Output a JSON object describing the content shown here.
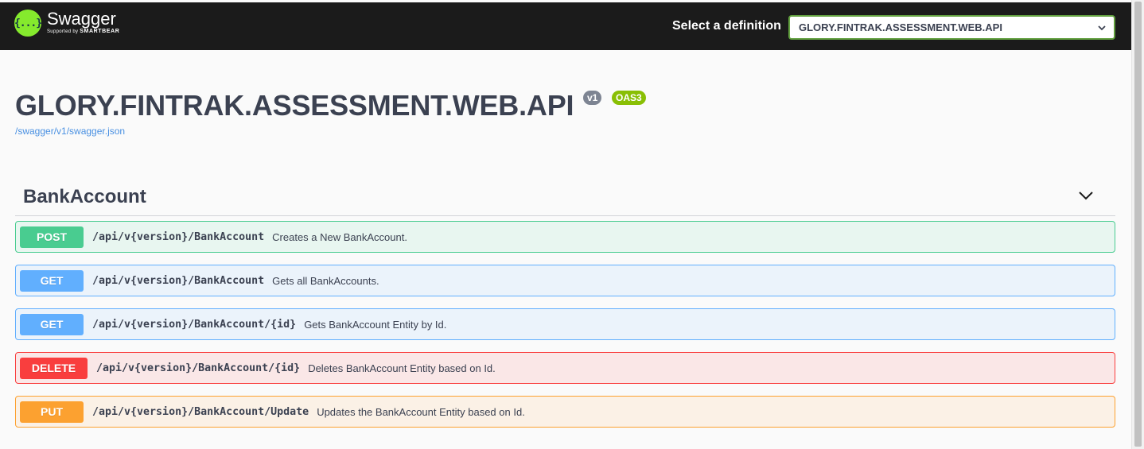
{
  "header": {
    "logo": {
      "glyph": "{...}",
      "name": "Swagger",
      "sub_prefix": "Supported by",
      "sub_brand": "SMARTBEAR"
    },
    "definition_label": "Select a definition",
    "definition_selected": "GLORY.FINTRAK.ASSESSMENT.WEB.API"
  },
  "info": {
    "title": "GLORY.FINTRAK.ASSESSMENT.WEB.API",
    "version_badge": "v1",
    "oas_badge": "OAS3",
    "spec_link": "/swagger/v1/swagger.json"
  },
  "tag": {
    "name": "BankAccount",
    "operations": [
      {
        "method": "POST",
        "path": "/api/v{version}/BankAccount",
        "summary": "Creates a New BankAccount."
      },
      {
        "method": "GET",
        "path": "/api/v{version}/BankAccount",
        "summary": "Gets all BankAccounts."
      },
      {
        "method": "GET",
        "path": "/api/v{version}/BankAccount/{id}",
        "summary": "Gets BankAccount Entity by Id."
      },
      {
        "method": "DELETE",
        "path": "/api/v{version}/BankAccount/{id}",
        "summary": "Deletes BankAccount Entity based on Id."
      },
      {
        "method": "PUT",
        "path": "/api/v{version}/BankAccount/Update",
        "summary": "Updates the BankAccount Entity based on Id."
      }
    ]
  },
  "colors": {
    "post": "#49cc90",
    "get": "#61affe",
    "delete": "#f93e3e",
    "put": "#fca130",
    "topbar": "#1b1b1b",
    "logo": "#85ea2d",
    "oas_badge": "#89bf04",
    "version_badge": "#7d8492",
    "link": "#4990e2"
  }
}
